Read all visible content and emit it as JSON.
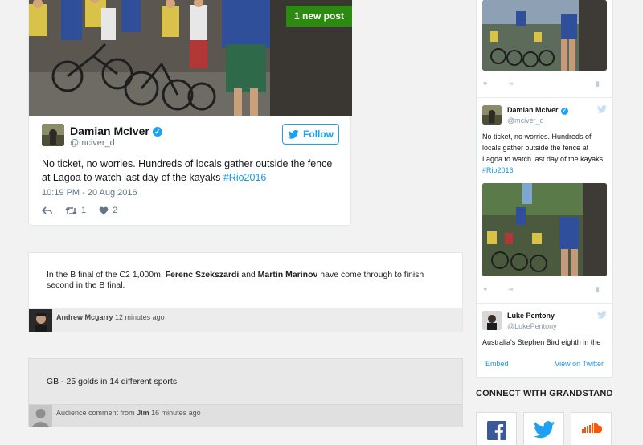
{
  "main_tweet": {
    "new_post_label": "1 new post",
    "author_name": "Damian McIver",
    "author_handle": "@mciver_d",
    "follow_label": "Follow",
    "text": "No ticket, no worries. Hundreds of locals gather outside the fence at Lagoa to watch last day of the kayaks ",
    "hashtag": "#Rio2016",
    "timestamp": "10:19 PM - 20 Aug 2016",
    "retweets": "1",
    "likes": "2"
  },
  "live_post": {
    "text_before": "In the B final of the C2 1,000m, ",
    "name_1": "Ferenc Szekszardi",
    "text_mid": " and ",
    "name_2": "Martin Marinov",
    "text_after": " have come through to finish second in the B final.",
    "author": "Andrew Mcgarry",
    "time": "12 minutes ago"
  },
  "audience_comment": {
    "text": "GB - 25 golds in 14 different sports",
    "label": "Audience comment from",
    "author": "Jim",
    "time": "16 minutes ago"
  },
  "sidebar": {
    "tweet_1": {
      "author_name": "Damian McIver",
      "author_handle": "@mciver_d",
      "text": "No ticket, no worries. Hundreds of locals gather outside the fence at Lagoa to watch last day of the kayaks ",
      "hashtag": "#Rio2016"
    },
    "tweet_2": {
      "author_name": "Luke Pentony",
      "author_handle": "@LukePentony",
      "text": "Australia's Stephen Bird eighth in the"
    },
    "embed_label": "Embed",
    "view_label": "View on Twitter"
  },
  "connect": {
    "title": "CONNECT WITH GRANDSTAND",
    "buttons": [
      "facebook-icon",
      "twitter-icon",
      "soundcloud-icon"
    ]
  },
  "colors": {
    "twitter_blue": "#1da1f2",
    "new_post_green": "#2b8a0f",
    "facebook_blue": "#3b5998",
    "soundcloud_orange": "#ff5500"
  }
}
